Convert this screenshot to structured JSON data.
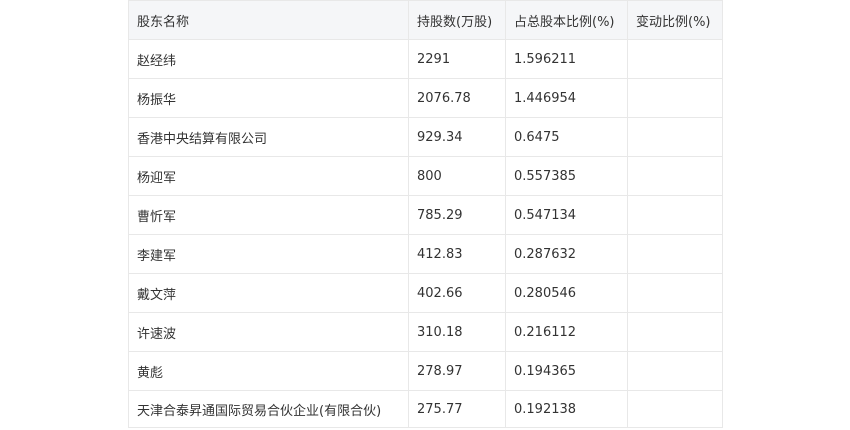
{
  "table": {
    "headers": [
      "股东名称",
      "持股数(万股)",
      "占总股本比例(%)",
      "变动比例(%)"
    ],
    "rows": [
      [
        "赵经纬",
        "2291",
        "1.596211",
        ""
      ],
      [
        "杨振华",
        "2076.78",
        "1.446954",
        ""
      ],
      [
        "香港中央结算有限公司",
        "929.34",
        "0.6475",
        ""
      ],
      [
        "杨迎军",
        "800",
        "0.557385",
        ""
      ],
      [
        "曹忻军",
        "785.29",
        "0.547134",
        ""
      ],
      [
        "李建军",
        "412.83",
        "0.287632",
        ""
      ],
      [
        "戴文萍",
        "402.66",
        "0.280546",
        ""
      ],
      [
        "许速波",
        "310.18",
        "0.216112",
        ""
      ],
      [
        "黄彪",
        "278.97",
        "0.194365",
        ""
      ],
      [
        "天津合泰昇通国际贸易合伙企业(有限合伙)",
        "275.77",
        "0.192138",
        ""
      ]
    ]
  }
}
